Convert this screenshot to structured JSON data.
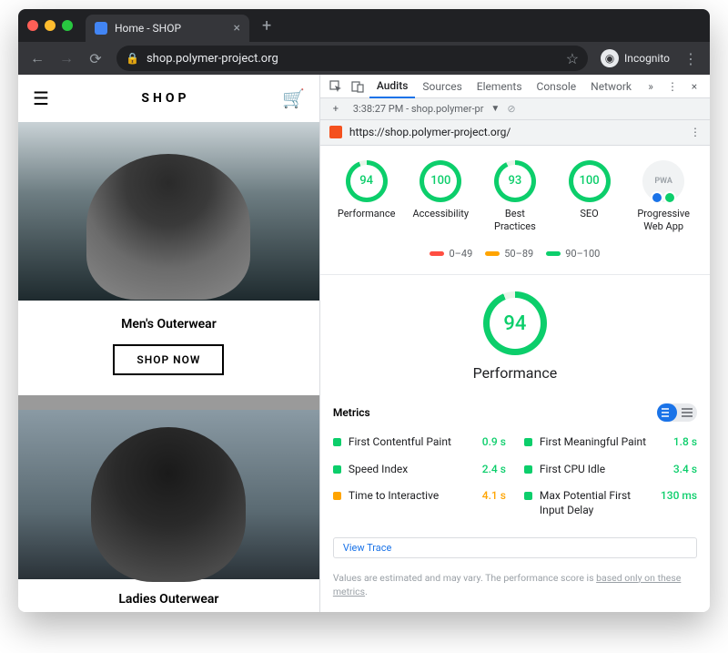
{
  "browser": {
    "tab_title": "Home - SHOP",
    "url_display": "shop.polymer-project.org",
    "incognito_label": "Incognito"
  },
  "page": {
    "brand": "SHOP",
    "hero1_title": "Men's Outerwear",
    "shop_now": "SHOP NOW",
    "hero2_title": "Ladies Outerwear"
  },
  "devtools": {
    "tabs": [
      "Audits",
      "Sources",
      "Elements",
      "Console",
      "Network"
    ],
    "active_tab": "Audits",
    "sub_time": "3:38:27 PM - shop.polymer-pr",
    "audit_url": "https://shop.polymer-project.org/",
    "gauges": [
      {
        "score": 94,
        "label": "Performance"
      },
      {
        "score": 100,
        "label": "Accessibility"
      },
      {
        "score": 93,
        "label": "Best Practices"
      },
      {
        "score": 100,
        "label": "SEO"
      }
    ],
    "pwa_label": "Progressive Web App",
    "legend": [
      {
        "range": "0–49",
        "color": "#ff4e42"
      },
      {
        "range": "50–89",
        "color": "#ffa400"
      },
      {
        "range": "90–100",
        "color": "#0cce6b"
      }
    ],
    "big_score": 94,
    "big_label": "Performance",
    "metrics_heading": "Metrics",
    "metrics": [
      {
        "name": "First Contentful Paint",
        "value": "0.9 s",
        "color": "#0cce6b",
        "val_color": "#0cce6b"
      },
      {
        "name": "First Meaningful Paint",
        "value": "1.8 s",
        "color": "#0cce6b",
        "val_color": "#0cce6b"
      },
      {
        "name": "Speed Index",
        "value": "2.4 s",
        "color": "#0cce6b",
        "val_color": "#0cce6b"
      },
      {
        "name": "First CPU Idle",
        "value": "3.4 s",
        "color": "#0cce6b",
        "val_color": "#0cce6b"
      },
      {
        "name": "Time to Interactive",
        "value": "4.1 s",
        "color": "#ffa400",
        "val_color": "#ffa400"
      },
      {
        "name": "Max Potential First Input Delay",
        "value": "130 ms",
        "color": "#0cce6b",
        "val_color": "#0cce6b"
      }
    ],
    "view_trace": "View Trace",
    "disclaimer_a": "Values are estimated and may vary. The performance score is ",
    "disclaimer_link": "based only on these metrics",
    "disclaimer_b": "."
  }
}
